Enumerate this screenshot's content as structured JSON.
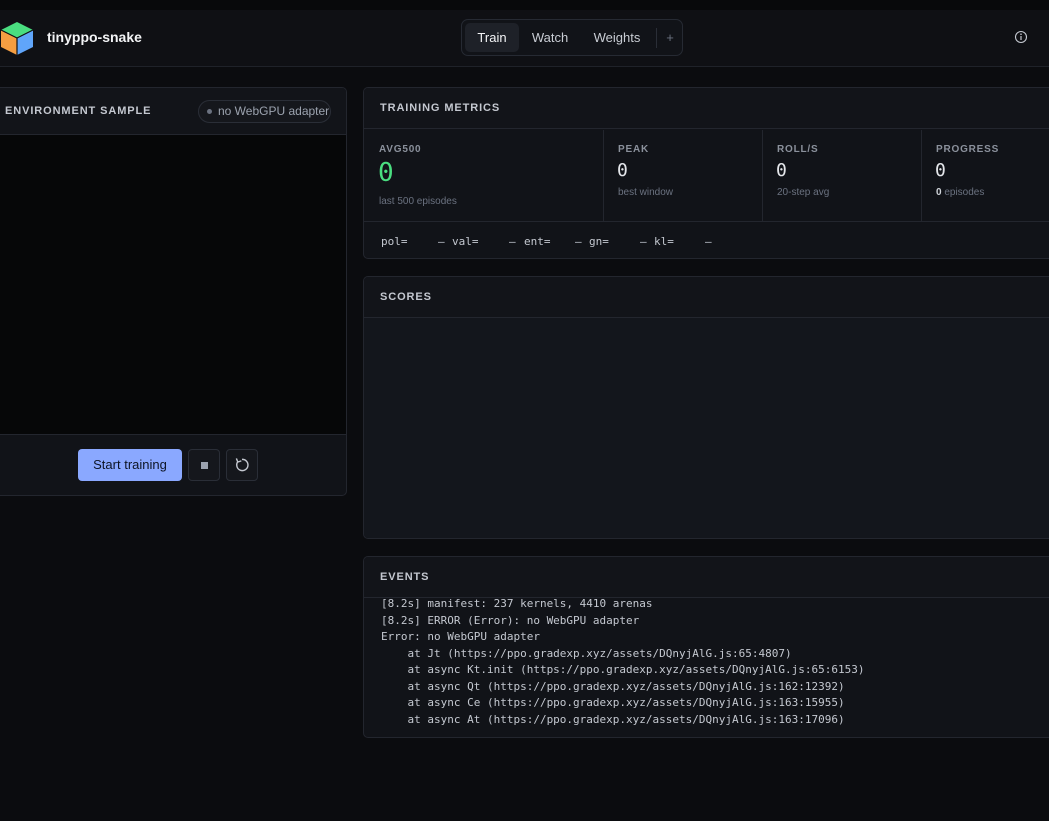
{
  "app": {
    "title": "tinyppo-snake"
  },
  "tabs": [
    {
      "label": "Train",
      "active": true
    },
    {
      "label": "Watch",
      "active": false
    },
    {
      "label": "Weights",
      "active": false
    }
  ],
  "tab_add_label": "+",
  "env": {
    "title": "ENVIRONMENT SAMPLE",
    "adapter_status": "no WebGPU adapter",
    "start_label": "Start training"
  },
  "metrics": {
    "title": "TRAINING METRICS",
    "avg500": {
      "label": "AVG500",
      "value": "0",
      "sub": "last 500 episodes"
    },
    "peak": {
      "label": "PEAK",
      "value": "0",
      "sub": "best window"
    },
    "roll": {
      "label": "ROLL/S",
      "value": "0",
      "sub": "20-step avg"
    },
    "progress": {
      "label": "PROGRESS",
      "value": "0",
      "count": "0",
      "sub": " episodes"
    },
    "stats": [
      {
        "key": "pol=",
        "value": "—"
      },
      {
        "key": "val=",
        "value": "—"
      },
      {
        "key": "ent=",
        "value": "—"
      },
      {
        "key": "gn=",
        "value": "—"
      },
      {
        "key": "kl=",
        "value": "—"
      }
    ]
  },
  "scores": {
    "title": "SCORES"
  },
  "events": {
    "title": "EVENTS",
    "lines": [
      "[8.2s] manifest: 237 kernels, 4410 arenas",
      "[8.2s] ERROR (Error): no WebGPU adapter",
      "Error: no WebGPU adapter",
      "    at Jt (https://ppo.gradexp.xyz/assets/DQnyjAlG.js:65:4807)",
      "    at async Kt.init (https://ppo.gradexp.xyz/assets/DQnyjAlG.js:65:6153)",
      "    at async Qt (https://ppo.gradexp.xyz/assets/DQnyjAlG.js:162:12392)",
      "    at async Ce (https://ppo.gradexp.xyz/assets/DQnyjAlG.js:163:15955)",
      "    at async At (https://ppo.gradexp.xyz/assets/DQnyjAlG.js:163:17096)"
    ]
  },
  "icons": {
    "logo": "cube-logo-icon",
    "info": "info-icon",
    "stop": "stop-icon",
    "reset": "reset-icon"
  },
  "colors": {
    "accent": "#8aa8ff",
    "positive": "#4ade80",
    "background": "#0b0c0f"
  }
}
